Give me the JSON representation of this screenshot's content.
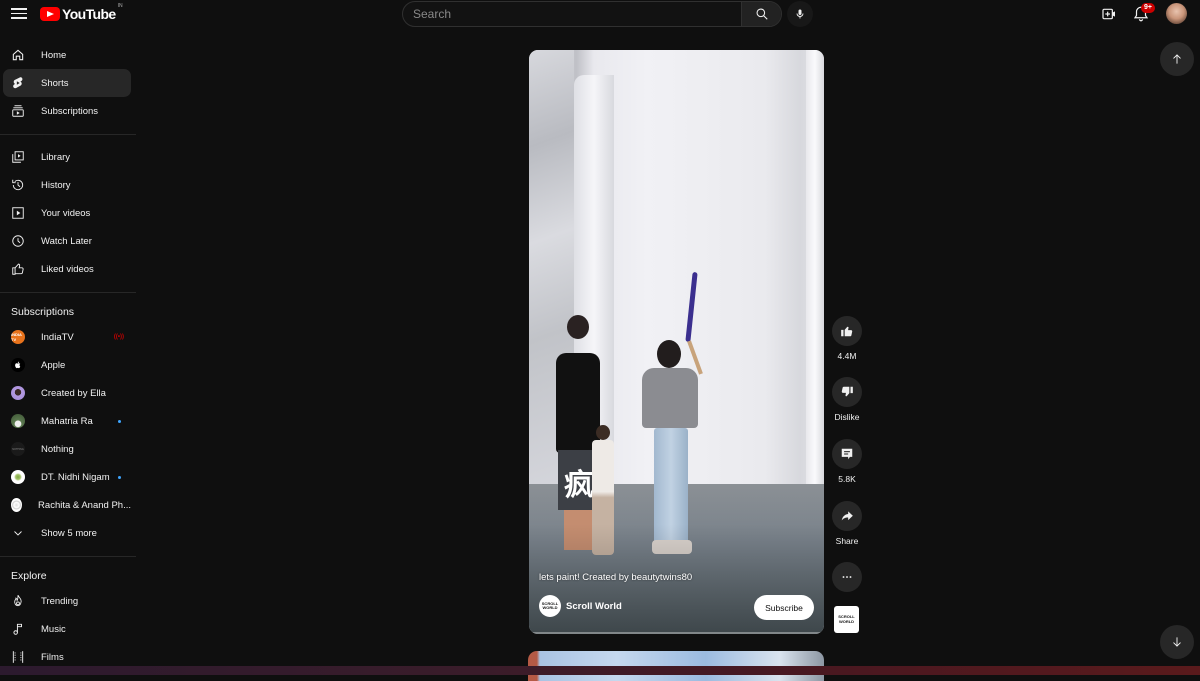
{
  "header": {
    "logo_text": "YouTube",
    "country_code": "IN",
    "search_placeholder": "Search",
    "notifications_badge": "9+"
  },
  "sidebar": {
    "main": [
      {
        "label": "Home",
        "icon": "home-icon"
      },
      {
        "label": "Shorts",
        "icon": "shorts-icon",
        "active": true
      },
      {
        "label": "Subscriptions",
        "icon": "subscriptions-icon"
      }
    ],
    "you": [
      {
        "label": "Library",
        "icon": "library-icon"
      },
      {
        "label": "History",
        "icon": "history-icon"
      },
      {
        "label": "Your videos",
        "icon": "your-videos-icon"
      },
      {
        "label": "Watch Later",
        "icon": "watch-later-icon"
      },
      {
        "label": "Liked videos",
        "icon": "liked-videos-icon"
      }
    ],
    "subscriptions_heading": "Subscriptions",
    "subscriptions": [
      {
        "label": "IndiaTV",
        "indicator": "live",
        "avatar_text": "INDIA TV",
        "avatar_color": "#e8731c"
      },
      {
        "label": "Apple",
        "indicator": "",
        "avatar_text": "",
        "avatar_color": "#000000"
      },
      {
        "label": "Created by Ella",
        "indicator": "",
        "avatar_text": "",
        "avatar_color": "#a48ad8"
      },
      {
        "label": "Mahatria Ra",
        "indicator": "new",
        "avatar_text": "",
        "avatar_color": "#4f6b45"
      },
      {
        "label": "Nothing",
        "indicator": "",
        "avatar_text": "NOTHING",
        "avatar_color": "#1a1a1a"
      },
      {
        "label": "DT. Nidhi Nigam",
        "indicator": "new",
        "avatar_text": "",
        "avatar_color": "#ffffff"
      },
      {
        "label": "Rachita & Anand Ph...",
        "indicator": "",
        "avatar_text": "",
        "avatar_color": "#ffffff"
      }
    ],
    "show_more": "Show 5 more",
    "live_glyph": "((•))",
    "explore_heading": "Explore",
    "explore": [
      {
        "label": "Trending",
        "icon": "trending-icon"
      },
      {
        "label": "Music",
        "icon": "music-icon"
      },
      {
        "label": "Films",
        "icon": "films-icon"
      }
    ]
  },
  "short": {
    "caption": "lets paint! Created by beautytwins80",
    "channel_name": "Scroll World",
    "channel_logo_text": "SCROLL WORLD",
    "subscribe_label": "Subscribe",
    "overlay_glyph": "疯"
  },
  "actions": {
    "likes": "4.4M",
    "dislike_label": "Dislike",
    "comments": "5.8K",
    "share_label": "Share",
    "audio_thumb_text": "SCROLL WORLD"
  },
  "colors": {
    "brand_red": "#ff0000",
    "background": "#0f0f0f",
    "active_item": "#272727",
    "new_dot": "#3ea6ff",
    "live_red": "#cc0000"
  }
}
